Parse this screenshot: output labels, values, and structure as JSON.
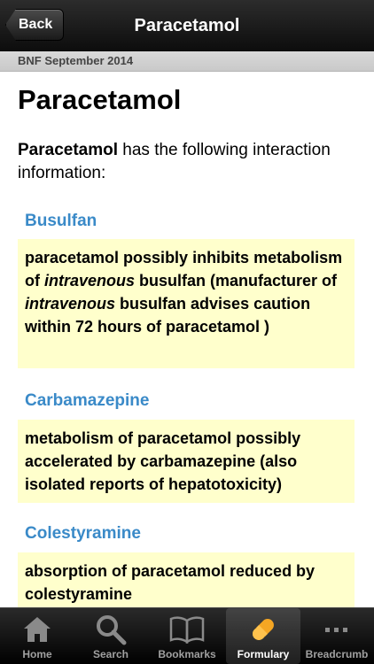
{
  "navbar": {
    "back_label": "Back",
    "title": "Paracetamol"
  },
  "subheader": {
    "text": "BNF September 2014"
  },
  "main": {
    "title": "Paracetamol",
    "intro_drug": "Paracetamol",
    "intro_rest": " has the following interaction information:",
    "interactions": [
      {
        "name": "Busulfan",
        "parts": [
          "paracetamol possibly inhibits metabolism of ",
          "intravenous",
          " busulfan (manufacturer of ",
          "intravenous",
          " busulfan advises caution within 72 hours of paracetamol )"
        ]
      },
      {
        "name": "Carbamazepine",
        "text": "metabolism of paracetamol possibly accelerated by carbamazepine (also isolated reports of hepatotoxicity)"
      },
      {
        "name": "Colestyramine",
        "text": "absorption of paracetamol reduced by colestyramine"
      }
    ]
  },
  "tabbar": {
    "items": [
      {
        "label": "Home",
        "icon": "home-icon"
      },
      {
        "label": "Search",
        "icon": "search-icon"
      },
      {
        "label": "Bookmarks",
        "icon": "book-icon"
      },
      {
        "label": "Formulary",
        "icon": "pill-icon",
        "active": true
      },
      {
        "label": "Breadcrumb",
        "icon": "more-dots-icon"
      }
    ]
  },
  "colors": {
    "accent_heading": "#3a8ac8",
    "interaction_bg": "#ffffcc",
    "active_tab_icon": "#f5a623"
  }
}
